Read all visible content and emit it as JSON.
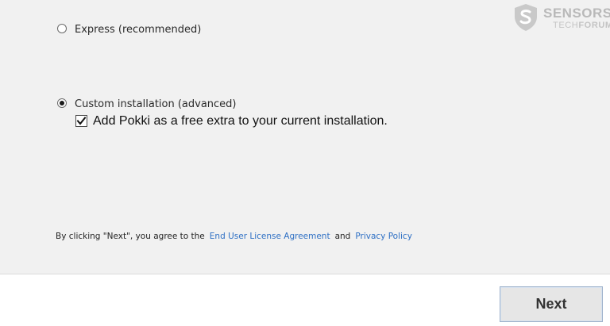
{
  "watermark": {
    "line1": "SENSORS",
    "line2_light": "TECH",
    "line2_bold": "FORUM"
  },
  "options": {
    "express": {
      "label": "Express (recommended)",
      "selected": false
    },
    "custom": {
      "label": "Custom installation (advanced)",
      "selected": true
    }
  },
  "extra": {
    "label": "Add Pokki as a free extra to your current installation.",
    "checked": true
  },
  "agreement": {
    "prefix": "By clicking \"Next\", you agree to the",
    "eula_link": "End User License Agreement",
    "conjunction": "and",
    "privacy_link": "Privacy Policy"
  },
  "footer": {
    "next_label": "Next"
  },
  "icons": {
    "watermark": "shield-logo-icon",
    "check": "checkmark-icon"
  },
  "colors": {
    "link": "#2d6fc4",
    "panel": "#f1f1f1"
  }
}
